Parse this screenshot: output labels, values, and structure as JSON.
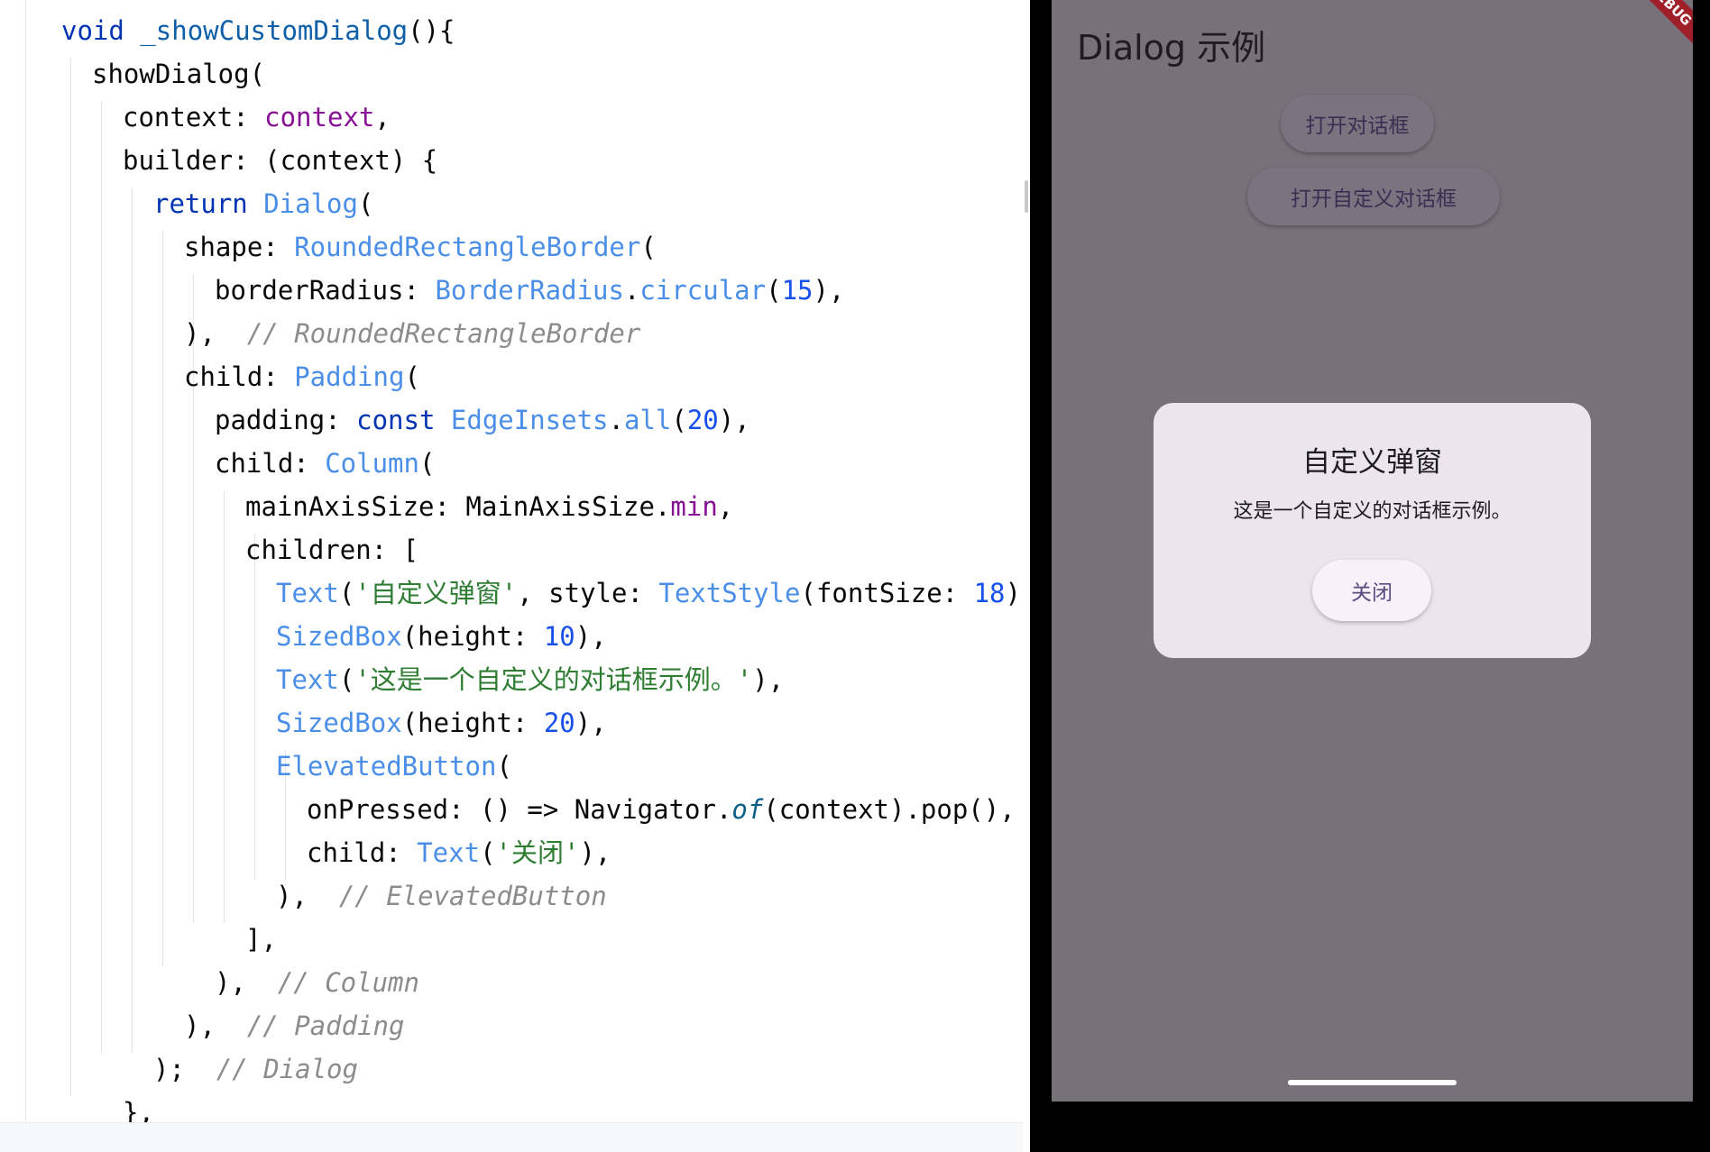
{
  "editor": {
    "lines": [
      [
        {
          "t": "void ",
          "c": "kw"
        },
        {
          "t": "_showCustomDialog",
          "c": "id"
        },
        {
          "t": "(){",
          "c": "p"
        }
      ],
      [
        {
          "t": "showDialog(",
          "c": "p"
        }
      ],
      [
        {
          "t": "context: ",
          "c": "p"
        },
        {
          "t": "context",
          "c": "prop"
        },
        {
          "t": ",",
          "c": "p"
        }
      ],
      [
        {
          "t": "builder: (context) {",
          "c": "p"
        }
      ],
      [
        {
          "t": "return ",
          "c": "kw"
        },
        {
          "t": "Dialog",
          "c": "cls"
        },
        {
          "t": "(",
          "c": "p"
        }
      ],
      [
        {
          "t": "shape: ",
          "c": "p"
        },
        {
          "t": "RoundedRectangleBorder",
          "c": "cls"
        },
        {
          "t": "(",
          "c": "p"
        }
      ],
      [
        {
          "t": "borderRadius: ",
          "c": "p"
        },
        {
          "t": "BorderRadius",
          "c": "cls"
        },
        {
          "t": ".",
          "c": "p"
        },
        {
          "t": "circular",
          "c": "fn"
        },
        {
          "t": "(",
          "c": "p"
        },
        {
          "t": "15",
          "c": "num"
        },
        {
          "t": "),",
          "c": "p"
        }
      ],
      [
        {
          "t": "),  ",
          "c": "p"
        },
        {
          "t": "// RoundedRectangleBorder",
          "c": "cmt"
        }
      ],
      [
        {
          "t": "child: ",
          "c": "p"
        },
        {
          "t": "Padding",
          "c": "cls"
        },
        {
          "t": "(",
          "c": "p"
        }
      ],
      [
        {
          "t": "padding: ",
          "c": "p"
        },
        {
          "t": "const ",
          "c": "kw"
        },
        {
          "t": "EdgeInsets",
          "c": "cls"
        },
        {
          "t": ".",
          "c": "p"
        },
        {
          "t": "all",
          "c": "fn"
        },
        {
          "t": "(",
          "c": "p"
        },
        {
          "t": "20",
          "c": "num"
        },
        {
          "t": "),",
          "c": "p"
        }
      ],
      [
        {
          "t": "child: ",
          "c": "p"
        },
        {
          "t": "Column",
          "c": "cls"
        },
        {
          "t": "(",
          "c": "p"
        }
      ],
      [
        {
          "t": "mainAxisSize: MainAxisSize.",
          "c": "p"
        },
        {
          "t": "min",
          "c": "prop"
        },
        {
          "t": ",",
          "c": "p"
        }
      ],
      [
        {
          "t": "children: [",
          "c": "p"
        }
      ],
      [
        {
          "t": "Text",
          "c": "cls"
        },
        {
          "t": "(",
          "c": "p"
        },
        {
          "t": "'自定义弹窗'",
          "c": "str"
        },
        {
          "t": ", style: ",
          "c": "p"
        },
        {
          "t": "TextStyle",
          "c": "cls"
        },
        {
          "t": "(fontSize: ",
          "c": "p"
        },
        {
          "t": "18",
          "c": "num"
        },
        {
          "t": ")),",
          "c": "p"
        }
      ],
      [
        {
          "t": "SizedBox",
          "c": "cls"
        },
        {
          "t": "(height: ",
          "c": "p"
        },
        {
          "t": "10",
          "c": "num"
        },
        {
          "t": "),",
          "c": "p"
        }
      ],
      [
        {
          "t": "Text",
          "c": "cls"
        },
        {
          "t": "(",
          "c": "p"
        },
        {
          "t": "'这是一个自定义的对话框示例。'",
          "c": "str"
        },
        {
          "t": "),",
          "c": "p"
        }
      ],
      [
        {
          "t": "SizedBox",
          "c": "cls"
        },
        {
          "t": "(height: ",
          "c": "p"
        },
        {
          "t": "20",
          "c": "num"
        },
        {
          "t": "),",
          "c": "p"
        }
      ],
      [
        {
          "t": "ElevatedButton",
          "c": "cls"
        },
        {
          "t": "(",
          "c": "p"
        }
      ],
      [
        {
          "t": "onPressed: () => Navigator.",
          "c": "p"
        },
        {
          "t": "of",
          "c": "it"
        },
        {
          "t": "(context).pop(),",
          "c": "p"
        }
      ],
      [
        {
          "t": "child: ",
          "c": "p"
        },
        {
          "t": "Text",
          "c": "cls"
        },
        {
          "t": "(",
          "c": "p"
        },
        {
          "t": "'关闭'",
          "c": "str"
        },
        {
          "t": "),",
          "c": "p"
        }
      ],
      [
        {
          "t": "),  ",
          "c": "p"
        },
        {
          "t": "// ElevatedButton",
          "c": "cmt"
        }
      ],
      [
        {
          "t": "],",
          "c": "p"
        }
      ],
      [
        {
          "t": "),  ",
          "c": "p"
        },
        {
          "t": "// Column",
          "c": "cmt"
        }
      ],
      [
        {
          "t": "),  ",
          "c": "p"
        },
        {
          "t": "// Padding",
          "c": "cmt"
        }
      ],
      [
        {
          "t": ");  ",
          "c": "p"
        },
        {
          "t": "// Dialog",
          "c": "cmt"
        }
      ],
      [
        {
          "t": "},",
          "c": "p"
        }
      ]
    ]
  },
  "app": {
    "title": "Dialog 示例",
    "open_dialog_button": "打开对话框",
    "open_custom_dialog_button": "打开自定义对话框",
    "debug_banner": "DEBUG"
  },
  "dialog": {
    "title": "自定义弹窗",
    "body": "这是一个自定义的对话框示例。",
    "close_button": "关闭"
  },
  "colors": {
    "keyword": "#0033b3",
    "class": "#4a8ee8",
    "string": "#2e7d32",
    "number": "#1750eb",
    "comment": "#8c8c8c",
    "scrim": "#77727a",
    "dialog_surface": "#ece5ef",
    "debug_banner": "#a0202a"
  }
}
